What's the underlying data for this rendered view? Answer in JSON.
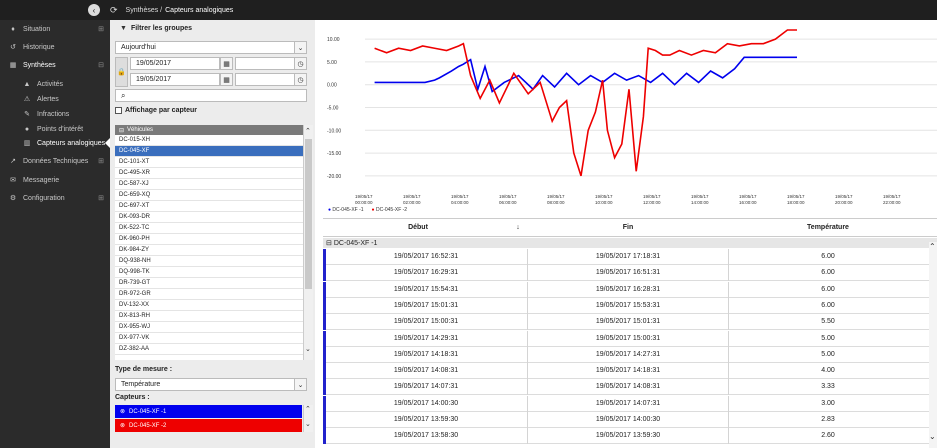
{
  "breadcrumb": {
    "parent": "Synthèses /",
    "current": "Capteurs analogiques"
  },
  "sidebar": {
    "items": [
      {
        "label": "Situation",
        "icon": "pin-icon",
        "expand": "⊞"
      },
      {
        "label": "Historique",
        "icon": "history-icon",
        "expand": ""
      },
      {
        "label": "Synthèses",
        "icon": "table-icon",
        "expand": "⊟"
      },
      {
        "label": "Activités",
        "icon": "road-icon",
        "expand": ""
      },
      {
        "label": "Alertes",
        "icon": "warning-icon",
        "expand": ""
      },
      {
        "label": "Infractions",
        "icon": "gavel-icon",
        "expand": ""
      },
      {
        "label": "Points d'intérêt",
        "icon": "info-icon",
        "expand": ""
      },
      {
        "label": "Capteurs analogiques",
        "icon": "chart-icon",
        "expand": ""
      },
      {
        "label": "Données Techniques",
        "icon": "line-chart-icon",
        "expand": "⊞"
      },
      {
        "label": "Messagerie",
        "icon": "envelope-icon",
        "expand": ""
      },
      {
        "label": "Configuration",
        "icon": "cogs-icon",
        "expand": "⊞"
      }
    ]
  },
  "filter": {
    "title": "Filtrer les groupes",
    "period": "Aujourd'hui",
    "date_from": "19/05/2017",
    "date_to": "19/05/2017",
    "search_placeholder": "",
    "per_sensor_label": "Affichage par capteur",
    "vehicles_header": "Véhicules",
    "vehicles": [
      "DC-015-XH",
      "DC-045-XF",
      "DC-101-XT",
      "DC-495-XR",
      "DC-587-XJ",
      "DC-659-XQ",
      "DC-697-XT",
      "DK-093-DR",
      "DK-522-TC",
      "DK-960-PH",
      "DK-984-ZY",
      "DQ-938-NH",
      "DQ-998-TK",
      "DR-739-GT",
      "DR-972-GR",
      "DV-132-XX",
      "DX-813-RH",
      "DX-955-WJ",
      "DX-977-VK",
      "DZ-382-AA"
    ],
    "selected_vehicle": "DC-045-XF",
    "measure_label": "Type de mesure :",
    "measure_value": "Température",
    "sensors_label": "Capteurs :",
    "sensors": [
      {
        "name": "DC-045-XF -1",
        "color": "#0000ee"
      },
      {
        "name": "DC-045-XF -2",
        "color": "#ee0000"
      }
    ]
  },
  "chart_data": {
    "type": "line",
    "ylim": [
      -22,
      12
    ],
    "yticks": [
      "10.00",
      "5.00",
      "0.00",
      "-5.00",
      "-10.00",
      "-15.00",
      "-20.00"
    ],
    "ytick_values": [
      10,
      5,
      0,
      -5,
      -10,
      -15,
      -20
    ],
    "xticks": [
      [
        "19/05/17",
        "00:00:00"
      ],
      [
        "19/05/17",
        "02:00:00"
      ],
      [
        "19/05/17",
        "04:00:00"
      ],
      [
        "19/05/17",
        "06:00:00"
      ],
      [
        "19/05/17",
        "08:00:00"
      ],
      [
        "19/05/17",
        "10:00:00"
      ],
      [
        "19/05/17",
        "12:00:00"
      ],
      [
        "19/05/17",
        "14:00:00"
      ],
      [
        "19/05/17",
        "16:00:00"
      ],
      [
        "19/05/17",
        "18:00:00"
      ],
      [
        "19/05/17",
        "20:00:00"
      ],
      [
        "19/05/17",
        "22:00:00"
      ]
    ],
    "xtick_hours": [
      0,
      2,
      4,
      6,
      8,
      10,
      12,
      14,
      16,
      18,
      20,
      22
    ],
    "series": [
      {
        "name": "DC-045-XF -1",
        "color": "#0000ee",
        "hours": [
          0.4,
          1.5,
          2.5,
          2.9,
          3.1,
          3.6,
          3.9,
          4.1,
          4.4,
          4.7,
          5.0,
          5.3,
          5.8,
          6.4,
          7.0,
          7.4,
          7.9,
          8.4,
          8.9,
          9.4,
          9.9,
          10.4,
          10.9,
          11.4,
          11.9,
          12.4,
          12.9,
          13.4,
          13.9,
          14.4,
          14.9,
          15.4,
          15.8,
          16.3,
          16.9,
          17.4,
          17.9,
          18.0
        ],
        "values": [
          0.5,
          0.5,
          0.5,
          1.0,
          1.5,
          3.0,
          4.0,
          4.5,
          5.5,
          -1.0,
          4.0,
          -1.5,
          0.5,
          2.0,
          -1.0,
          2.0,
          -0.5,
          2.5,
          0.0,
          2.0,
          0.5,
          2.5,
          1.0,
          2.0,
          0.5,
          2.5,
          0.0,
          2.5,
          0.5,
          3.0,
          1.5,
          3.5,
          6.0,
          6.0,
          6.0,
          6.0,
          6.0,
          6.0
        ]
      },
      {
        "name": "DC-045-XF -2",
        "color": "#ee0000",
        "hours": [
          0.4,
          0.9,
          1.4,
          1.9,
          2.4,
          2.9,
          3.4,
          3.9,
          4.1,
          4.4,
          4.8,
          5.2,
          5.6,
          6.2,
          6.8,
          7.3,
          7.8,
          8.1,
          8.4,
          8.7,
          9.0,
          9.3,
          9.6,
          9.9,
          10.1,
          10.4,
          10.7,
          11.0,
          11.3,
          11.6,
          11.8,
          12.1,
          12.4,
          12.7,
          13.1,
          13.6,
          14.1,
          14.6,
          15.1,
          15.6,
          16.1,
          16.6,
          17.1,
          17.6,
          18.0
        ],
        "values": [
          8.0,
          7.0,
          8.0,
          7.5,
          8.5,
          8.0,
          7.5,
          8.5,
          9.0,
          2.0,
          -3.0,
          1.0,
          -4.0,
          2.5,
          -2.0,
          0.5,
          -8.0,
          -5.0,
          -3.5,
          -15.0,
          -20.0,
          -10.0,
          -6.0,
          1.0,
          -10.0,
          -16.0,
          -13.0,
          -1.0,
          -19.0,
          -7.0,
          8.0,
          7.5,
          6.5,
          6.5,
          7.5,
          6.5,
          7.5,
          7.0,
          9.0,
          8.5,
          9.0,
          9.0,
          10.0,
          12.0,
          12.0
        ]
      }
    ]
  },
  "table": {
    "headers": {
      "start": "Début",
      "sort_icon": "↓",
      "end": "Fin",
      "temp": "Température"
    },
    "group": "DC-045-XF -1",
    "rows": [
      {
        "start": "19/05/2017 16:52:31",
        "end": "19/05/2017 17:18:31",
        "temp": "6.00"
      },
      {
        "start": "19/05/2017 16:29:31",
        "end": "19/05/2017 16:51:31",
        "temp": "6.00"
      },
      {
        "start": "19/05/2017 15:54:31",
        "end": "19/05/2017 16:28:31",
        "temp": "6.00"
      },
      {
        "start": "19/05/2017 15:01:31",
        "end": "19/05/2017 15:53:31",
        "temp": "6.00"
      },
      {
        "start": "19/05/2017 15:00:31",
        "end": "19/05/2017 15:01:31",
        "temp": "5.50"
      },
      {
        "start": "19/05/2017 14:29:31",
        "end": "19/05/2017 15:00:31",
        "temp": "5.00"
      },
      {
        "start": "19/05/2017 14:18:31",
        "end": "19/05/2017 14:27:31",
        "temp": "5.00"
      },
      {
        "start": "19/05/2017 14:08:31",
        "end": "19/05/2017 14:18:31",
        "temp": "4.00"
      },
      {
        "start": "19/05/2017 14:07:31",
        "end": "19/05/2017 14:08:31",
        "temp": "3.33"
      },
      {
        "start": "19/05/2017 14:00:30",
        "end": "19/05/2017 14:07:31",
        "temp": "3.00"
      },
      {
        "start": "19/05/2017 13:59:30",
        "end": "19/05/2017 14:00:30",
        "temp": "2.83"
      },
      {
        "start": "19/05/2017 13:58:30",
        "end": "19/05/2017 13:59:30",
        "temp": "2.60"
      }
    ]
  }
}
